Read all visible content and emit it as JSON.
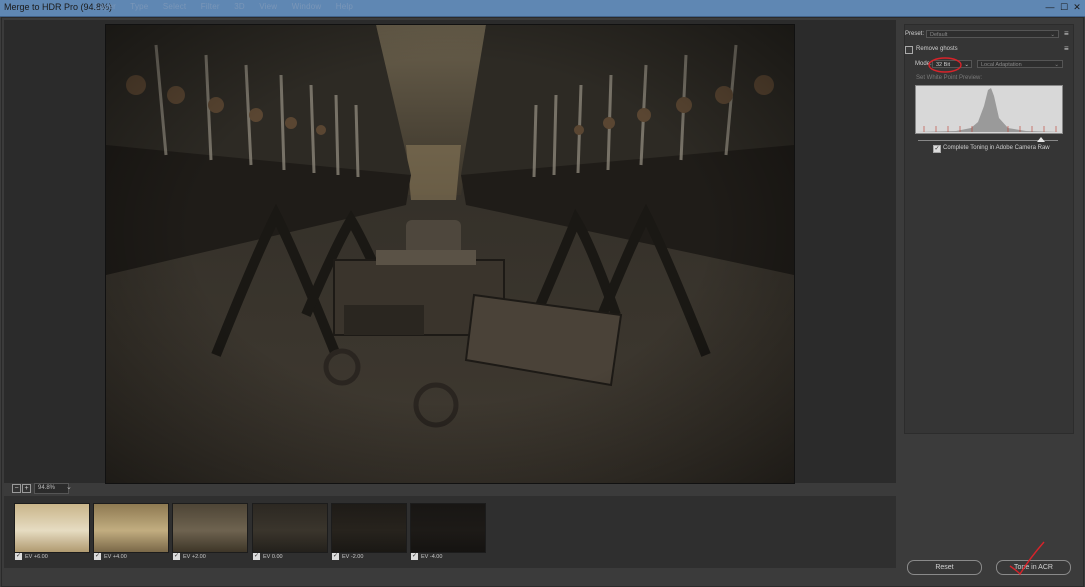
{
  "window": {
    "title": "Merge to HDR Pro (94.8%)",
    "menu_ghost": [
      "Layer",
      "Type",
      "Select",
      "Filter",
      "3D",
      "View",
      "Window",
      "Help"
    ],
    "controls": [
      "—",
      "☐",
      "✕"
    ]
  },
  "preview": {
    "zoom_value": "94.8%"
  },
  "filmstrip": {
    "items": [
      {
        "label": "EV +6.00",
        "checked": true
      },
      {
        "label": "EV +4.00",
        "checked": true
      },
      {
        "label": "EV +2.00",
        "checked": true
      },
      {
        "label": "EV 0.00",
        "checked": true
      },
      {
        "label": "EV -2.00",
        "checked": true
      },
      {
        "label": "EV -4.00",
        "checked": true
      }
    ]
  },
  "panel": {
    "preset_label": "Preset:",
    "preset_value": "Default",
    "remove_ghosts_label": "Remove ghosts",
    "mode_label": "Mode:",
    "mode_value": "32 Bit",
    "method_value": "Local Adaptation",
    "white_point_label": "Set White Point Preview:",
    "complete_toning_label": "Complete Toning in Adobe Camera Raw",
    "complete_toning_checked": true,
    "menu_icon": "panel-menu-icon"
  },
  "buttons": {
    "reset": "Reset",
    "tone_in_acr": "Tone in ACR"
  },
  "colors": {
    "annotation_red": "#d8232a",
    "titlebar": "#5f87b3",
    "background": "#3b3b3b"
  }
}
